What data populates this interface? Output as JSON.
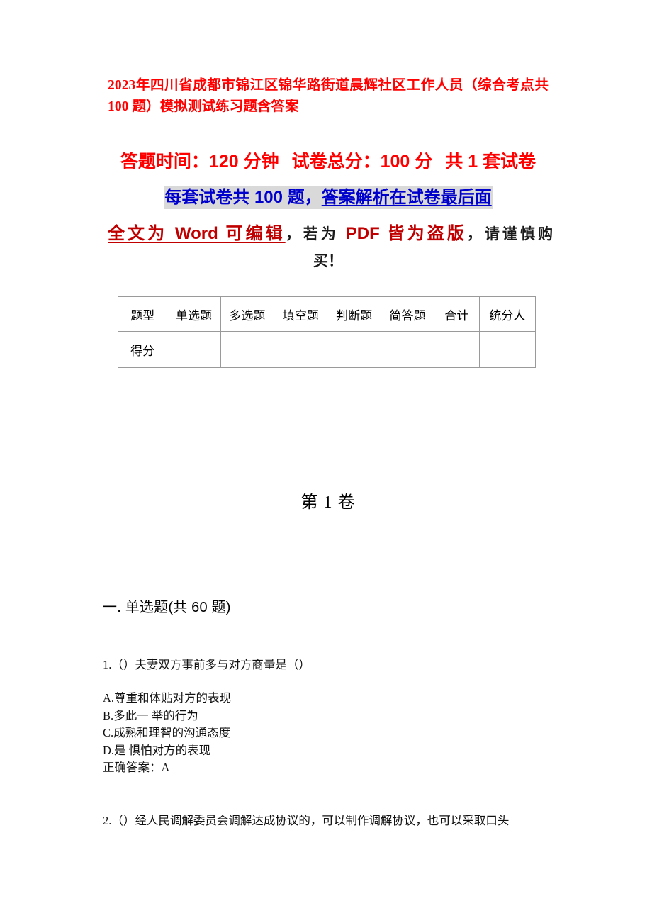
{
  "document": {
    "title": "2023年四川省成都市锦江区锦华路街道晨辉社区工作人员（综合考点共 100 题）模拟测试练习题含答案",
    "exam_info": {
      "duration_label": "答题时间：120 分钟",
      "total_score_label": "试卷总分：100 分",
      "set_count_label": "共 1 套试卷",
      "per_set_note_prefix": "每套试卷共 100 题，",
      "per_set_note_underlined": "答案解析在试卷最后面"
    },
    "notice": {
      "part_red_underlined": "全文为 Word 可编辑",
      "part_black_1": "，若为 ",
      "part_crimson": "PDF 皆为盗版",
      "part_black_2": "，请谨慎购",
      "part_black_3": "买！"
    },
    "score_table": {
      "headers": [
        "题型",
        "单选题",
        "多选题",
        "填空题",
        "判断题",
        "简答题",
        "合计",
        "统分人"
      ],
      "rows": [
        {
          "label": "得分",
          "values": [
            "",
            "",
            "",
            "",
            "",
            "",
            ""
          ]
        }
      ]
    },
    "volume_heading": "第 1 卷",
    "sections": [
      {
        "heading": "一. 单选题(共 60 题)",
        "questions": [
          {
            "stem": "1.（）夫妻双方事前多与对方商量是（）",
            "options": [
              "A.尊重和体贴对方的表现",
              "B.多此一 举的行为",
              "C.成熟和理智的沟通态度",
              "D.是 惧怕对方的表现"
            ],
            "answer": "正确答案：A"
          },
          {
            "stem": "2.（）经人民调解委员会调解达成协议的，可以制作调解协议，也可以采取口头",
            "options": [],
            "answer": ""
          }
        ]
      }
    ],
    "colors": {
      "title_red": "#ff0000",
      "info_red": "#ff0000",
      "highlight_blue": "#0000cc",
      "highlight_bg": "#d9d9d9",
      "crimson": "#c00000",
      "body_black": "#111111",
      "table_border": "#9a9a9a"
    }
  }
}
